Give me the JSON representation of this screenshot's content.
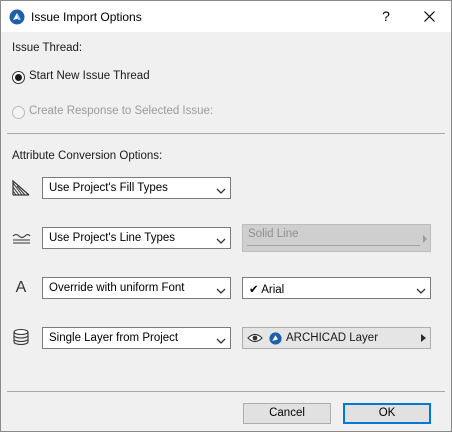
{
  "window": {
    "title": "Issue Import Options",
    "help_label": "?"
  },
  "issue_thread": {
    "heading": "Issue Thread:",
    "options": [
      {
        "label": "Start New Issue Thread",
        "checked": true,
        "enabled": true
      },
      {
        "label": "Create Response to Selected Issue:",
        "checked": false,
        "enabled": false
      }
    ]
  },
  "attribute_conversion": {
    "heading": "Attribute Conversion Options:",
    "rows": [
      {
        "icon": "fill-types-icon",
        "selected": "Use Project's Fill Types"
      },
      {
        "icon": "line-types-icon",
        "selected": "Use Project's Line Types",
        "secondary": {
          "value": "Solid Line",
          "enabled": false
        }
      },
      {
        "icon": "font-icon",
        "icon_glyph": "A",
        "selected": "Override with uniform Font",
        "secondary": {
          "value": "Arial",
          "checkmark": "✔"
        }
      },
      {
        "icon": "layers-icon",
        "selected": "Single Layer from Project",
        "secondary": {
          "value": "ARCHICAD Layer",
          "icons": [
            "eye-icon",
            "archicad-layer-icon"
          ]
        }
      }
    ]
  },
  "buttons": {
    "cancel_label": "Cancel",
    "ok_label": "OK"
  },
  "colors": {
    "dialog_bg": "#f0f0f0",
    "titlebar_bg": "#ffffff",
    "accent": "#0078d7",
    "disabled_text": "#9b9b9b"
  }
}
